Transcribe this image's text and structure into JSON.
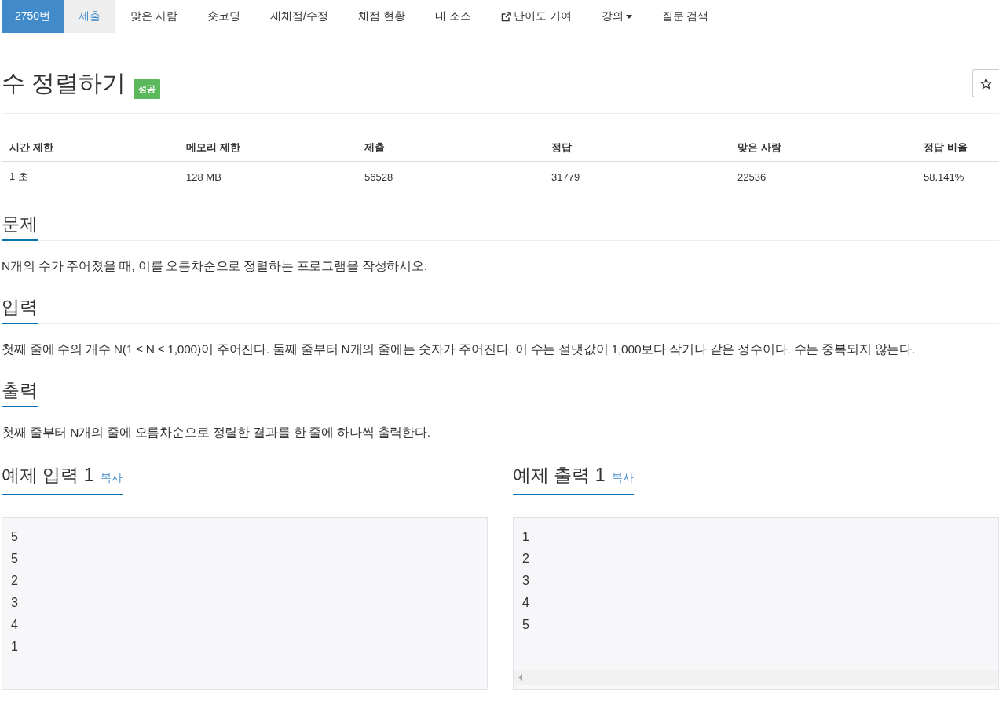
{
  "nav": {
    "problem_id": "2750번",
    "items": [
      {
        "label": "제출",
        "selected": true,
        "kind": "plain"
      },
      {
        "label": "맞은 사람",
        "selected": false,
        "kind": "plain"
      },
      {
        "label": "숏코딩",
        "selected": false,
        "kind": "plain"
      },
      {
        "label": "재채점/수정",
        "selected": false,
        "kind": "plain"
      },
      {
        "label": "채점 현황",
        "selected": false,
        "kind": "plain"
      },
      {
        "label": "내 소스",
        "selected": false,
        "kind": "plain"
      },
      {
        "label": "난이도 기여",
        "selected": false,
        "kind": "external"
      },
      {
        "label": "강의",
        "selected": false,
        "kind": "dropdown"
      },
      {
        "label": "질문 검색",
        "selected": false,
        "kind": "plain"
      }
    ]
  },
  "title": "수 정렬하기",
  "badge": "성공",
  "info_table": {
    "columns": [
      "시간 제한",
      "메모리 제한",
      "제출",
      "정답",
      "맞은 사람",
      "정답 비율"
    ],
    "row": [
      "1 초",
      "128 MB",
      "56528",
      "31779",
      "22536",
      "58.141%"
    ]
  },
  "sections": [
    {
      "heading": "문제",
      "body": "N개의 수가 주어졌을 때, 이를 오름차순으로 정렬하는 프로그램을 작성하시오."
    },
    {
      "heading": "입력",
      "body": "첫째 줄에 수의 개수 N(1 ≤ N ≤ 1,000)이 주어진다. 둘째 줄부터 N개의 줄에는 숫자가 주어진다. 이 수는 절댓값이 1,000보다 작거나 같은 정수이다. 수는 중복되지 않는다."
    },
    {
      "heading": "출력",
      "body": "첫째 줄부터 N개의 줄에 오름차순으로 정렬한 결과를 한 줄에 하나씩 출력한다."
    }
  ],
  "samples": [
    {
      "heading": "예제 입력 1",
      "copy": "복사",
      "lines": [
        "5",
        "5",
        "2",
        "3",
        "4",
        "1"
      ],
      "horizontal_scrollbar": false
    },
    {
      "heading": "예제 출력 1",
      "copy": "복사",
      "lines": [
        "1",
        "2",
        "3",
        "4",
        "5"
      ],
      "horizontal_scrollbar": true
    }
  ]
}
